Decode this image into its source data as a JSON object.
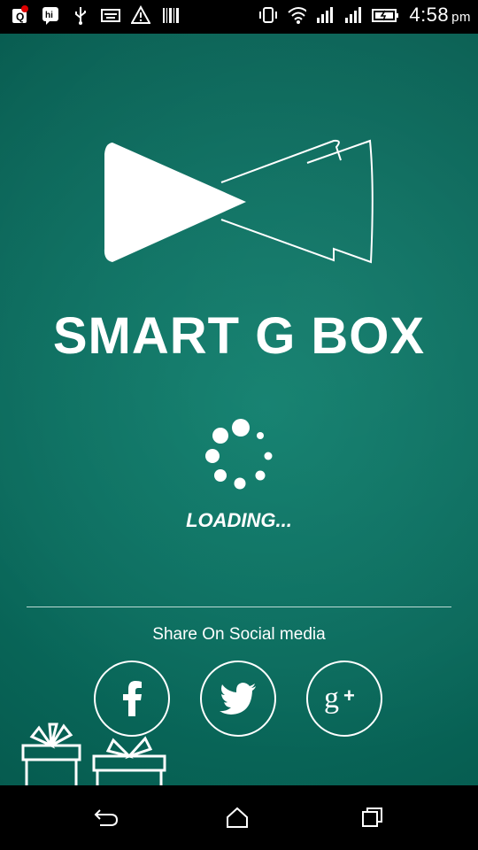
{
  "status_bar": {
    "time": "4:58",
    "ampm": "pm",
    "left_icons": [
      "q-notification-icon",
      "hike-icon",
      "usb-icon",
      "keyboard-icon",
      "warning-icon",
      "barcode-icon"
    ],
    "right_icons": [
      "vibrate-icon",
      "wifi-icon",
      "signal-icon",
      "signal-icon",
      "battery-icon"
    ]
  },
  "app": {
    "title": "SMART G BOX",
    "loading": "LOADING..."
  },
  "share": {
    "label": "Share On Social media",
    "buttons": [
      "facebook",
      "twitter",
      "google-plus"
    ]
  },
  "colors": {
    "background": "#0a6f60",
    "foreground": "#ffffff"
  },
  "nav": [
    "back-icon",
    "home-icon",
    "recents-icon"
  ]
}
